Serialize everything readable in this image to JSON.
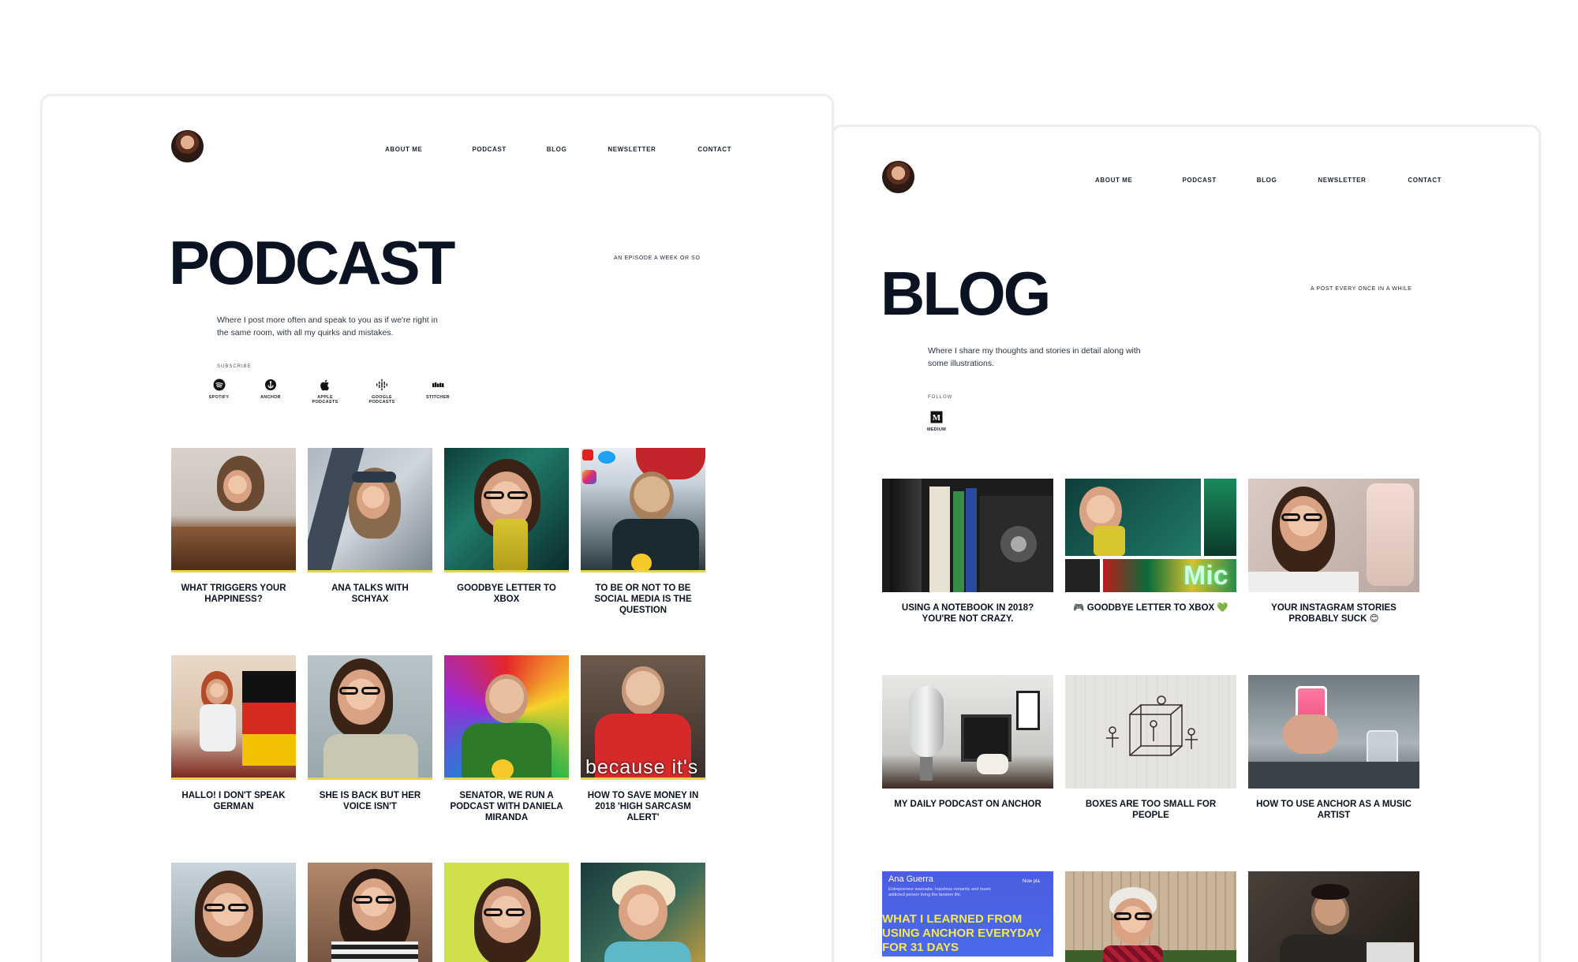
{
  "podcast_page": {
    "nav": [
      "ABOUT ME",
      "PODCAST",
      "BLOG",
      "NEWSLETTER",
      "CONTACT"
    ],
    "title": "PODCAST",
    "tagline": "AN EPISODE A WEEK OR SO",
    "intro": "Where I post more often and speak to you as if we're right in the same room, with all my quirks and mistakes.",
    "subscribe_label": "SUBSCRIBE",
    "platforms": [
      {
        "label": "SPOTIFY",
        "icon": "spotify-icon"
      },
      {
        "label": "ANCHOR",
        "icon": "anchor-icon"
      },
      {
        "label": "APPLE PODCASTS",
        "icon": "apple-icon"
      },
      {
        "label": "GOOGLE PODCASTS",
        "icon": "google-podcasts-icon"
      },
      {
        "label": "STITCHER",
        "icon": "stitcher-icon"
      }
    ],
    "episodes": [
      {
        "title": "WHAT TRIGGERS YOUR HAPPINESS?"
      },
      {
        "title": "ANA TALKS WITH SCHYAX"
      },
      {
        "title": "GOODBYE LETTER TO XBOX"
      },
      {
        "title": "TO BE OR NOT TO BE SOCIAL MEDIA IS THE QUESTION"
      },
      {
        "title": "HALLO! I DON'T SPEAK GERMAN"
      },
      {
        "title": "SHE IS BACK BUT HER VOICE ISN'T"
      },
      {
        "title": "SENATOR, WE RUN A PODCAST WITH DANIELA MIRANDA"
      },
      {
        "title": "HOW TO SAVE MONEY IN 2018 'HIGH SARCASM ALERT'"
      },
      {
        "title": ""
      },
      {
        "title": ""
      },
      {
        "title": ""
      },
      {
        "title": ""
      }
    ],
    "thumb_overlay_text": "because it's"
  },
  "blog_page": {
    "nav": [
      "ABOUT ME",
      "PODCAST",
      "BLOG",
      "NEWSLETTER",
      "CONTACT"
    ],
    "title": "BLOG",
    "tagline": "A POST EVERY ONCE IN A WHILE",
    "intro": "Where I share my thoughts and stories in detail along with some illustrations.",
    "follow_label": "FOLLOW",
    "platforms": [
      {
        "label": "MEDIUM",
        "icon": "medium-icon"
      }
    ],
    "posts": [
      {
        "title": "USING A NOTEBOOK IN 2018? YOU'RE NOT CRAZY."
      },
      {
        "title": "🎮 GOODBYE LETTER TO XBOX 💚"
      },
      {
        "title": "YOUR INSTAGRAM STORIES PROBABLY SUCK 😊"
      },
      {
        "title": "MY DAILY PODCAST ON ANCHOR"
      },
      {
        "title": "BOXES ARE TOO SMALL FOR PEOPLE"
      },
      {
        "title": "HOW TO USE ANCHOR AS A MUSIC ARTIST"
      },
      {
        "title": ""
      },
      {
        "title": ""
      },
      {
        "title": ""
      }
    ],
    "anchor_thumb": {
      "name": "Ana Guerra",
      "bio": "Entrepreneur wannabe, hopeless romantic and music addicted person living the fandom life.",
      "now_playing": "Now pla",
      "headline": "WHAT I LEARNED FROM USING ANCHOR EVERYDAY FOR 31 DAYS"
    },
    "xbox_thumb_text": "Mic"
  },
  "colors": {
    "ink": "#0b1322",
    "accent_yellow": "#e8d44a",
    "window_border": "#eceef1"
  }
}
